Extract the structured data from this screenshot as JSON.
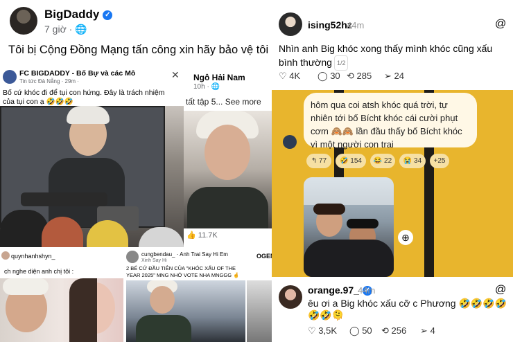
{
  "facebook": {
    "author": "BigDaddy",
    "verified_icon": "verified-badge-icon",
    "time": "7 giờ",
    "privacy_icon": "globe-icon",
    "post_text": "Tôi bị Cộng Đồng Mạng tấn công xin hãy bảo vệ tôi"
  },
  "collage": {
    "panel1": {
      "page_name": "FC BIGDADDY - Bố Bự và các Mô",
      "page_sub": "Tin tức Đà Nẵng · 29m ·",
      "close_icon": "close-icon",
      "caption": "Bố cứ khóc đi để tụi con hứng. Đây là trách nhiệm của tụi con ạ 🤣🤣🤣"
    },
    "panel2": {
      "name": "Ngô Hải Nam",
      "time": "10h ·",
      "caption": "tất tập 5... See more",
      "likes": "11.7K"
    },
    "panel3": {
      "name": "quynhanhshyn_",
      "caption": "ch nghe diện anh chị tôi :"
    },
    "panel4": {
      "name": "cungbendau_ · Anh Trai Say Hi Em",
      "name2": "Xinh Say Hi",
      "caption": "2 BÉ CỨ ĐẦU TIÊN CỦA \"KHÓC XẤU OF THE YEAR 2025\" MNG NHỚ VOTE NHA MNGGG 🤞"
    },
    "panel5": {
      "name": "OGENI"
    }
  },
  "threads_top": {
    "author": "ising52hz",
    "time": "44m",
    "logo": "@",
    "text": "Nhìn anh Big khóc xong thấy mình khóc cũng xấu bình thường",
    "page_badge": "1/2",
    "likes": "4K",
    "comments": "30",
    "reposts": "285",
    "shares": "24"
  },
  "chat": {
    "bubble_text": "hôm qua coi atsh khóc quá trời, tự nhiên tới bố Bícht khóc cái cười phụt cơm 🙈🙈 lần đầu thấy bố Bícht khóc vì một người con trai",
    "reactions": [
      {
        "label": "↰ 77"
      },
      {
        "label": "🤣 154"
      },
      {
        "label": "😂 22"
      },
      {
        "label": "😭 34"
      },
      {
        "label": "+25"
      }
    ],
    "add_icon": "add-reaction-icon"
  },
  "threads_bottom": {
    "author": "orange.97_",
    "time": "44m",
    "logo": "@",
    "text": "êu ơi a Big khóc xấu cỡ c Phương 🤣🤣🤣🤣🤣🤣🫠",
    "likes": "3,5K",
    "comments": "50",
    "reposts": "256",
    "shares": "4"
  }
}
